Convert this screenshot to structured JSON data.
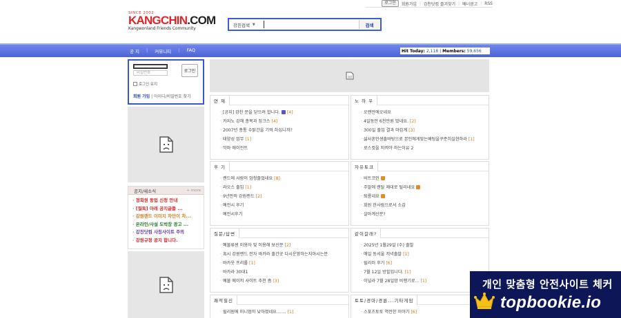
{
  "top_links": {
    "login": "로그인",
    "items": [
      "회원가입",
      "강친닷컴 즐겨찾기",
      "배너광고",
      "RSS"
    ]
  },
  "logo": {
    "since": "SINCE 2002",
    "brand_red": "KANGCHIN",
    "brand_dark": ".COM",
    "tagline": "Kangwonland Friends Community"
  },
  "search": {
    "select_label": "강친검색",
    "value": "",
    "button": "검색"
  },
  "nav": {
    "items": [
      "공 지",
      "커뮤니티",
      "FAQ"
    ],
    "hit_today_label": "Hit Today:",
    "hit_today": "2,118",
    "members_label": "Members:",
    "members": "59,656"
  },
  "login_box": {
    "id_value": "",
    "password_placeholder": "비밀번호",
    "login_button": "로그인",
    "keep_login": "로그인 유지",
    "join_label": "회원 가입",
    "find_label": " | 아이디/비밀번호 찾기"
  },
  "notice": {
    "title": "공지/새소식",
    "more": "+ more",
    "items": [
      {
        "text": "정회원 등업 신청 안내",
        "color": "#d42a2a"
      },
      {
        "text": "[필독] 아래 공지글들 ...",
        "color": "#d42a2a"
      },
      {
        "text": "강원랜드 이미지 차단이 차...",
        "color": "#d27a1a"
      },
      {
        "text": "온라인/사설 도박장 광고 ...",
        "color": "#2a7a2a"
      },
      {
        "text": "강친닷컴 사칭사이트 주의",
        "color": "#6a3ab0"
      },
      {
        "text": "강원규정 공지 합니다.",
        "color": "#d42a2a"
      }
    ]
  },
  "boards": [
    {
      "title": "연 재",
      "items": [
        {
          "text": "[공지] 강친 문을 닫으려 합니다.",
          "mark": true,
          "count": "[4]"
        },
        {
          "text": "카지노 강해 총목과 징크스",
          "count": "[4]"
        },
        {
          "text": "2007년 총통 수탉간을 기억 하십니까?",
          "count": ""
        },
        {
          "text": "태양성 업무",
          "count": "[1]"
        },
        {
          "text": "악마 에이전트",
          "count": ""
        }
      ]
    },
    {
      "title": "노 하 우",
      "items": [
        {
          "text": "오랜만에오네요",
          "count": ""
        },
        {
          "text": "4일동안 6천만원 땄네요.",
          "count": "[2]"
        },
        {
          "text": "300일 출입 결과 마감계",
          "count": "[3]"
        },
        {
          "text": "삶사혼인생출바탕으로 본인에게맞는베팅을꾸준히실현하라",
          "count": "[1]"
        },
        {
          "text": "로스컷을 지켜야 하는이유 2",
          "count": ""
        }
      ]
    },
    {
      "title": "후 기",
      "items": [
        {
          "text": "랜드에 사람이 엄청줄었네요",
          "count": "[8]"
        },
        {
          "text": "라오스 출입",
          "count": "[1]"
        },
        {
          "text": "9년만의 강원랜드",
          "count": "[2]"
        },
        {
          "text": "예전시 후기",
          "count": ""
        },
        {
          "text": "예전시후기",
          "count": ""
        }
      ]
    },
    {
      "title": "자유토크",
      "items": [
        {
          "text": "비트코인",
          "new": true,
          "count": ""
        },
        {
          "text": "주말에 랜탈 제대로 털리네요",
          "new": true,
          "count": ""
        },
        {
          "text": "퇴룡네요",
          "new": true,
          "count": ""
        },
        {
          "text": "회원 한사람으로서 소감",
          "count": ""
        },
        {
          "text": "살아계신분?",
          "count": ""
        }
      ]
    },
    {
      "title": "질문/답변",
      "items": [
        {
          "text": "예불류센 이용자 및 이용해 보신분",
          "count": "[2]"
        },
        {
          "text": "혹시 강원랜드 전자 바카라 출간곳 다시운영하는지아시는분",
          "count": ""
        },
        {
          "text": "바카웃 프리롤",
          "count": "[1]"
        },
        {
          "text": "바카라 30대1",
          "count": ""
        },
        {
          "text": "예불 메이저 사이트 추천 좀",
          "count": "[3]"
        }
      ]
    },
    {
      "title": "같이갈래?",
      "items": [
        {
          "text": "2025년 1월29일 (수) 출발",
          "count": ""
        },
        {
          "text": "매일 동서울 저녁출발",
          "count": "[1]"
        },
        {
          "text": "릴리러 후기",
          "count": "[6]"
        },
        {
          "text": "7월 12일 방힐입니다.",
          "count": "[1]"
        },
        {
          "text": "이널라 7월 28일밤 비행기로...",
          "count": "[1]"
        }
      ]
    },
    {
      "title": "쾌적힐신",
      "items": [
        {
          "text": "릴리원에 미니멈이 낮아졌네요.......",
          "count": "[1]"
        }
      ]
    },
    {
      "title": "토토/경마/경륜...기타게임",
      "items": [
        {
          "text": "스포츠토토 역전한 이야기",
          "count": "[6]"
        }
      ]
    }
  ],
  "ad": {
    "line1": "개인 맞춤형 안전사이트 체커",
    "line2": "topbookie.io"
  }
}
